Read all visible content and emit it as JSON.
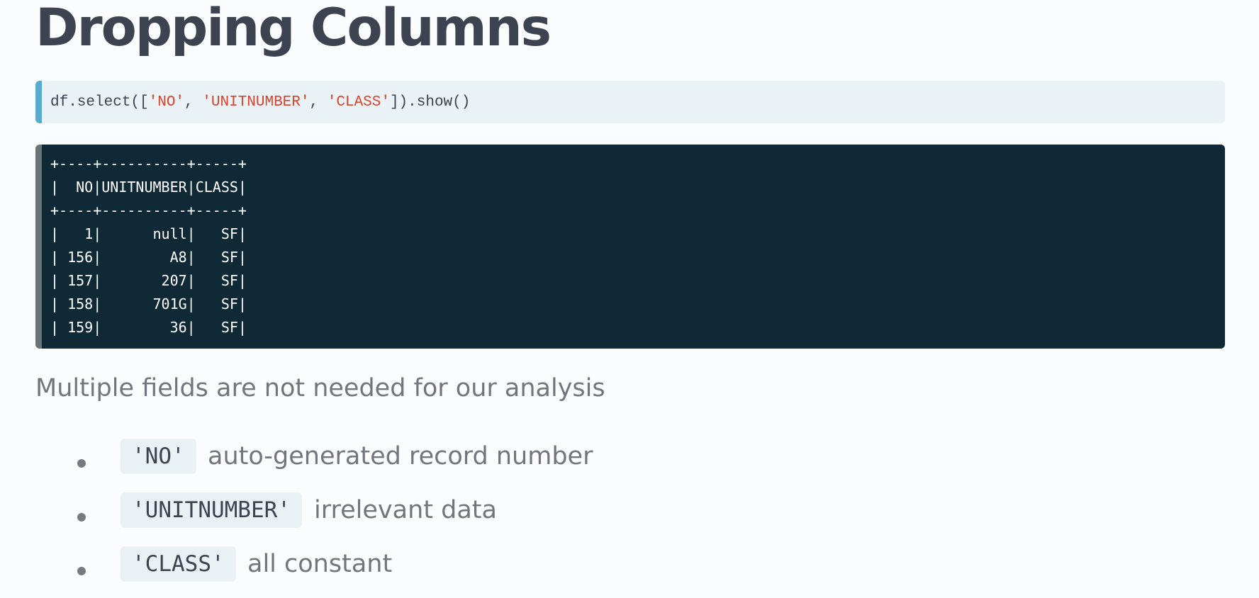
{
  "title": "Dropping Columns",
  "code_input": {
    "prefix": "df.select([",
    "col1": "'NO'",
    "sep1": ", ",
    "col2": "'UNITNUMBER'",
    "sep2": ", ",
    "col3": "'CLASS'",
    "suffix": "]).show()"
  },
  "code_output": {
    "lines": [
      "+----+----------+-----+",
      "|  NO|UNITNUMBER|CLASS|",
      "+----+----------+-----+",
      "|   1|      null|   SF|",
      "| 156|        A8|   SF|",
      "| 157|       207|   SF|",
      "| 158|      701G|   SF|",
      "| 159|        36|   SF|"
    ]
  },
  "subtitle": "Multiple fields are not needed for our analysis",
  "bullets": [
    {
      "code": "'NO'",
      "text": "auto-generated record number"
    },
    {
      "code": "'UNITNUMBER'",
      "text": "irrelevant data"
    },
    {
      "code": "'CLASS'",
      "text": "all constant"
    }
  ],
  "colors": {
    "title": "#3d4351",
    "body_text": "#71767e",
    "string_literal": "#d7432e",
    "input_bg": "#ebf2f6",
    "input_accent": "#5aaad0",
    "output_bg": "#0f2a36",
    "output_accent": "#697476"
  }
}
